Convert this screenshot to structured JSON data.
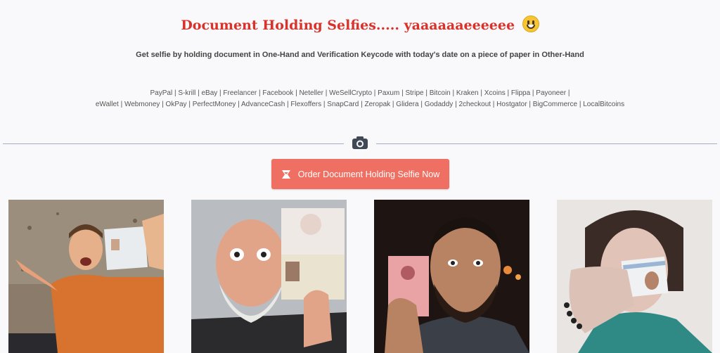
{
  "header": {
    "title": "Document Holding Selfies..... yaaaaaaeeeeee",
    "emoji_icon": "grinning-face-icon",
    "subtitle": "Get selfie by holding document in One-Hand and Verification Keycode with today's date on a piece of paper in Other-Hand"
  },
  "platforms": {
    "line1": "PayPal | S-krill | eBay | Freelancer | Facebook | Neteller | WeSellCrypto | Paxum | Stripe | Bitcoin | Kraken | Xcoins | Flippa | Payoneer |",
    "line2": "eWallet | Webmoney | OkPay | PerfectMoney | AdvanceCash | Flexoffers | SnapCard | Zeropak | Glidera | Godaddy | 2checkout | Hostgator | BigCommerce | LocalBitcoins"
  },
  "divider": {
    "icon": "camera-icon"
  },
  "cta": {
    "label": "Order Document Holding Selfie Now",
    "icon": "badge-icon"
  },
  "colors": {
    "accent": "#d8322a",
    "button": "#ef6f63",
    "divider": "#9db0c8"
  },
  "gallery": [
    {
      "name": "man-with-passport-shouting"
    },
    {
      "name": "bald-man-with-passport"
    },
    {
      "name": "bearded-man-with-license"
    },
    {
      "name": "woman-with-id-card"
    }
  ]
}
